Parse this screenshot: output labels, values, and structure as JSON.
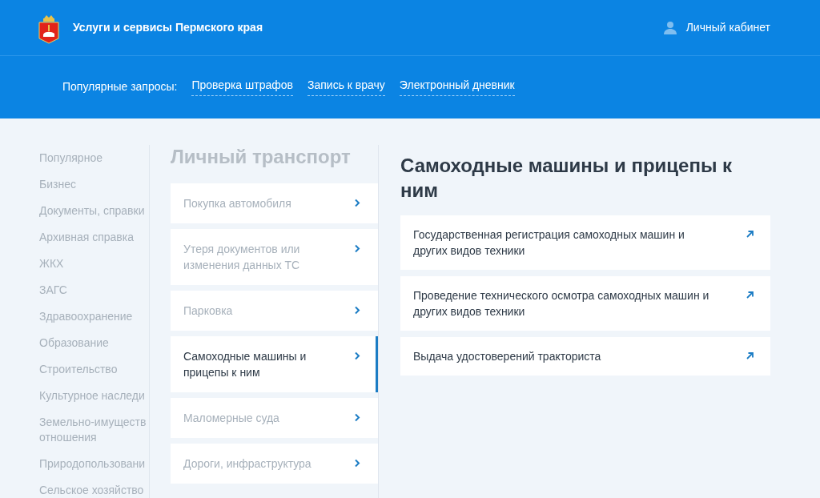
{
  "header": {
    "title": "Услуги и сервисы Пермского края",
    "account": "Личный кабинет"
  },
  "popular": {
    "label": "Популярные запросы:",
    "links": [
      "Проверка штрафов",
      "Запись к врачу",
      "Электронный дневник"
    ]
  },
  "sidebar": {
    "items": [
      {
        "label": "Популярное"
      },
      {
        "label": "Бизнес"
      },
      {
        "label": "Документы, справки"
      },
      {
        "label": "Архивная справка"
      },
      {
        "label": "ЖКХ"
      },
      {
        "label": "ЗАГС"
      },
      {
        "label": "Здравоохранение"
      },
      {
        "label": "Образование"
      },
      {
        "label": "Строительство"
      },
      {
        "label": "Культурное наследи"
      },
      {
        "label": "Земельно-имуществ отношения"
      },
      {
        "label": "Природопользовани"
      },
      {
        "label": "Сельское хозяйство"
      }
    ]
  },
  "category": {
    "title": "Личный транспорт",
    "items": [
      {
        "label": "Покупка автомобиля",
        "selected": false
      },
      {
        "label": "Утеря документов или изменения данных ТС",
        "selected": false
      },
      {
        "label": "Парковка",
        "selected": false
      },
      {
        "label": "Самоходные машины и прицепы к ним",
        "selected": true
      },
      {
        "label": "Маломерные суда",
        "selected": false
      },
      {
        "label": "Дороги, инфраструктура",
        "selected": false
      }
    ]
  },
  "services": {
    "title": "Самоходные машины и прицепы к ним",
    "items": [
      {
        "label": "Государственная регистрация самоходных машин и других видов техники"
      },
      {
        "label": "Проведение технического осмотра самоходных машин и других видов техники"
      },
      {
        "label": "Выдача удостоверений тракториста"
      }
    ]
  }
}
